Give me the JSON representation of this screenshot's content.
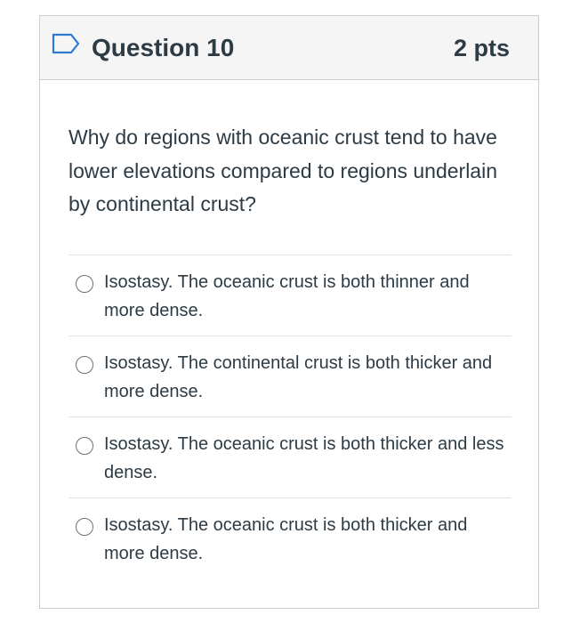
{
  "question": {
    "title": "Question 10",
    "points": "2 pts",
    "text": "Why do regions with oceanic crust tend to have lower elevations compared to regions underlain by continental crust?"
  },
  "answers": [
    {
      "label": "Isostasy. The oceanic crust is both thinner and more dense.",
      "selected": false
    },
    {
      "label": "Isostasy. The continental crust is both thicker and more dense.",
      "selected": false
    },
    {
      "label": "Isostasy. The oceanic crust is both thicker and less dense.",
      "selected": false
    },
    {
      "label": "Isostasy. The oceanic crust is both thicker and more dense.",
      "selected": false
    }
  ],
  "colors": {
    "text": "#2d3b45",
    "border": "#c7cdd1",
    "header_bg": "#f5f5f5",
    "flag": "#2d7bd1"
  },
  "icons": {
    "flag": "bookmark-flag-icon",
    "radio": "radio-button-icon"
  }
}
